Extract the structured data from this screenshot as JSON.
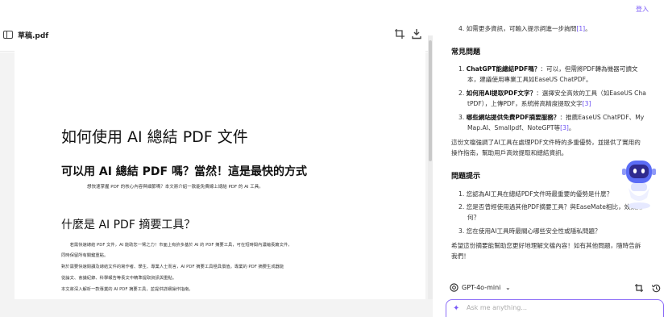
{
  "topbar": {
    "login_label": "登入"
  },
  "viewer": {
    "filename": "草稿.pdf",
    "document": {
      "title": "如何使用 AI 總結 PDF 文件",
      "h1": "可以用 AI 總結 PDF 嗎？當然！這是最快的方式",
      "subtitle": "想快速掌握 PDF 的核心內容與細節嗎？本文將介紹一款能免費線上總結 PDF 的 AI 工具。",
      "h2": "什麼是 AI PDF 摘要工具？",
      "paragraphs": [
        "　　若需快速總結 PDF 文件，AI 能助您一臂之力！市面上有許多基於 AI 的 PDF 摘要工具，可在短時間內濃縮長篇文件，",
        "同時保留所有關鍵重點。",
        "對於需要快速閱讀及總結文件的寫作者、學生、專業人士而言，AI PDF 摘要工具極具價值。專業的 PDF 摘要生成器能",
        "從論文、會議紀錄、科學報告等長文中精準提取資訊與重點。",
        "本文將深入解析一款專業的 AI PDF 摘要工具，並提供詳細操作指南。"
      ]
    }
  },
  "chat": {
    "top_item": {
      "text": "4. 如需更多資訊，可輸入提示詞進一步詢問",
      "cite": "[1]",
      "tail": "。"
    },
    "faq_heading": "常見問題",
    "faq": [
      {
        "bold": "ChatGPT能總結PDF嗎？",
        "line1": "：可以，但需將PDF轉為機器可讀文",
        "line2": "本，建議使用專業工具如EaseUS ChatPDF。",
        "cite": ""
      },
      {
        "bold": "如何用AI提取PDF文字？",
        "line1": "：選擇安全高效的工具（如EaseUS Cha",
        "line2": "tPDF），上傳PDF，系統將高精度提取文字",
        "cite": "[3]"
      },
      {
        "bold": "哪些網站提供免費PDF摘要服務？",
        "line1": "：推薦EaseUS ChatPDF、My",
        "line2": "Map.AI、Smallpdf、NoteGPT等",
        "cite": "[3]"
      }
    ],
    "summary_line1": "這份文檔強調了AI工具在處理PDF文件時的多重優勢，並提供了實用的",
    "summary_line2": "操作指南，幫助用戶高效提取和總結資訊。",
    "prompt_heading": "問題提示",
    "prompts": [
      {
        "line1": "1. 您認為AI工具在總結PDF文件時最重要的優勢是什麼？",
        "line2": ""
      },
      {
        "line1": "2. 您是否曾經使用過其他PDF摘要工具？與EaseMate相比，效果如",
        "line2": "何？"
      },
      {
        "line1": "3. 您在使用AI工具時最關心哪些安全性或隱私問題？",
        "line2": ""
      }
    ],
    "closing_line1": "希望這份摘要能幫助您更好地理解文檔內容！如有其他問題，隨時告訴",
    "closing_line2": "我們！",
    "model_name": "GPT-4o-mini",
    "input_placeholder": "Ask me anything..."
  },
  "colors": {
    "accent": "#7a5af8",
    "cite": "#6b4ff2",
    "robot": "#5b6cf6"
  },
  "icons": [
    "sidebar-toggle-icon",
    "crop-icon",
    "download-icon",
    "model-icon",
    "chevron-down-icon",
    "new-chat-icon",
    "history-icon",
    "sparkle-icon",
    "robot-assistant-icon"
  ]
}
